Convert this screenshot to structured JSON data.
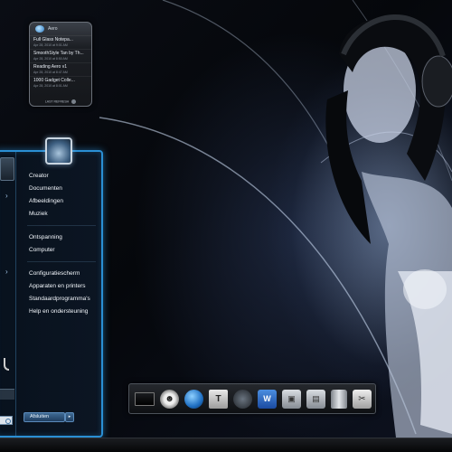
{
  "gadget": {
    "title": "Aero",
    "feeds": [
      {
        "title": "Full Glass Notepa...",
        "date": "Apr 28, 2010 at 9:01 AM"
      },
      {
        "title": "SmoothStyle Tan by Th...",
        "date": "Apr 28, 2010 at 8:50 AM"
      },
      {
        "title": "Reading Aero v1",
        "date": "Apr 28, 2010 at 8:47 AM"
      },
      {
        "title": "1000 Gadget Colle...",
        "date": "Apr 28, 2010 at 8:01 AM"
      }
    ],
    "footer": "LAST REFRESH"
  },
  "start_menu": {
    "links": {
      "creator": "Creator",
      "documents": "Documenten",
      "pictures": "Afbeeldingen",
      "music": "Muziek",
      "games": "Ontspanning",
      "computer": "Computer",
      "control_panel": "Configuratiescherm",
      "devices": "Apparaten en printers",
      "default_programs": "Standaardprogramma's",
      "help": "Help en ondersteuning"
    },
    "shutdown_label": "Afsluiten",
    "shutdown_arrow": "▸",
    "submenu_arrow": "›"
  },
  "dock": {
    "icons": [
      "monitor-icon",
      "smiley-icon",
      "globe-icon",
      "document-icon",
      "microphone-icon",
      "word-icon",
      "photoshop-icon",
      "applications-icon",
      "trash-icon",
      "tools-icon"
    ],
    "glyphs": {
      "face": "☻",
      "doc": "T",
      "word": "W",
      "ps": "▣",
      "apps": "▤",
      "tools": "✂"
    }
  },
  "colors": {
    "accent": "#2a8fd4",
    "background": "#000000"
  }
}
